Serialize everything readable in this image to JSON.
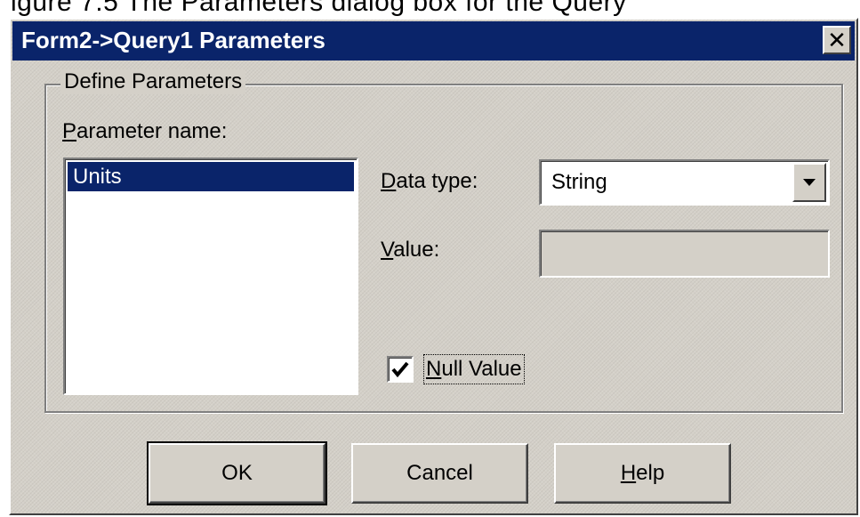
{
  "clipped_top_text": "igure 7.5 The Parameters dialog box for the Query",
  "window": {
    "title": "Form2->Query1 Parameters",
    "close_glyph": "✕"
  },
  "group": {
    "label": "Define Parameters"
  },
  "parameter_name": {
    "label_mnemonic": "P",
    "label_rest": "arameter name:",
    "items": [
      "Units"
    ],
    "selected_index": 0
  },
  "data_type": {
    "label_mnemonic": "D",
    "label_rest": "ata type:",
    "selected": "String"
  },
  "value": {
    "label_mnemonic": "V",
    "label_rest": "alue:",
    "current": ""
  },
  "null_value": {
    "label_mnemonic": "N",
    "label_rest": "ull Value",
    "checked": true
  },
  "buttons": {
    "ok": "OK",
    "cancel": "Cancel",
    "help_mnemonic": "H",
    "help_rest": "elp"
  },
  "colors": {
    "titlebar": "#0a246a",
    "face": "#d4d0c8",
    "selection": "#0a246a"
  },
  "icons": {
    "close": "close-icon",
    "dropdown": "chevron-down-icon",
    "check": "checkmark-icon"
  }
}
